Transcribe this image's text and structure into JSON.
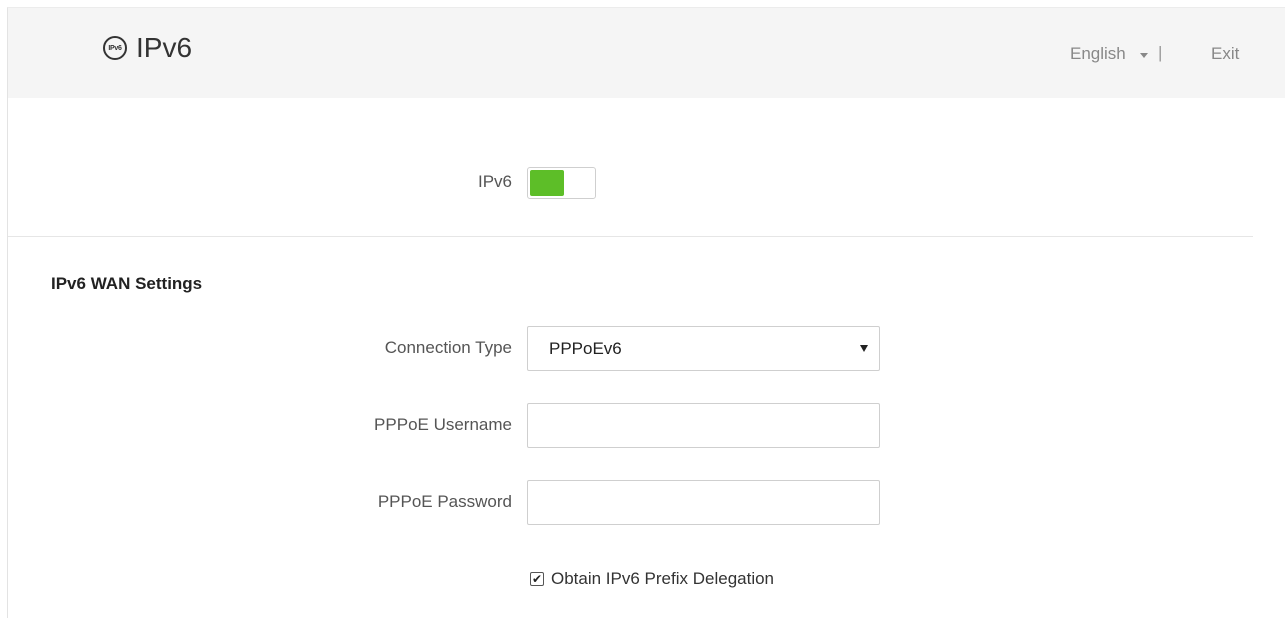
{
  "header": {
    "icon_text": "IPv6",
    "title": "IPv6",
    "language": "English",
    "separator": "|",
    "exit_label": "Exit"
  },
  "ipv6_toggle": {
    "label": "IPv6",
    "enabled": true,
    "on_color": "#5dbe28"
  },
  "wan_settings": {
    "section_title": "IPv6 WAN Settings",
    "connection_type": {
      "label": "Connection Type",
      "value": "PPPoEv6"
    },
    "username": {
      "label": "PPPoE Username",
      "value": ""
    },
    "password": {
      "label": "PPPoE Password",
      "value": ""
    },
    "prefix_delegation": {
      "label": "Obtain IPv6 Prefix Delegation",
      "checked": true
    }
  }
}
